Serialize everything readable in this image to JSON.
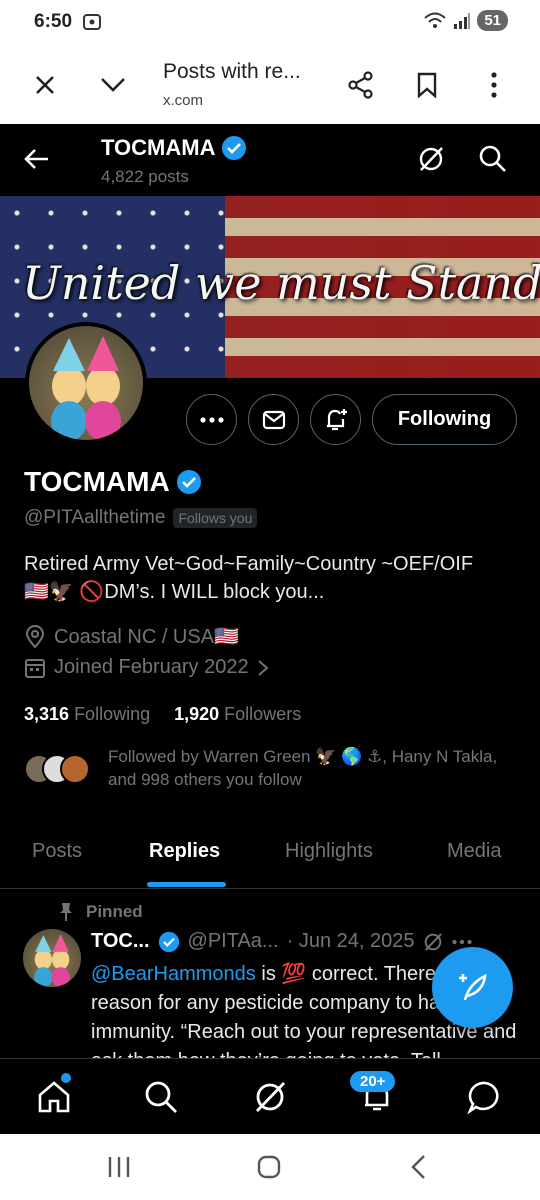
{
  "status": {
    "time": "6:50",
    "battery": "51"
  },
  "browser": {
    "title": "Posts with re...",
    "url": "x.com"
  },
  "header": {
    "name": "TOCMAMA",
    "posts": "4,822 posts"
  },
  "banner": {
    "text": "United we must Stand"
  },
  "actions": {
    "following_label": "Following"
  },
  "profile": {
    "name": "TOCMAMA",
    "handle": "@PITAallthetime",
    "follows_you": "Follows you",
    "bio_line1": "Retired Army Vet~God~Family~Country ~OEF/OIF",
    "bio_line2": "🇺🇸🦅 🚫DM’s. I WILL block you...",
    "location": "Coastal NC / USA🇺🇸",
    "joined": "Joined February 2022",
    "following_count": "3,316",
    "following_label": "Following",
    "followers_count": "1,920",
    "followers_label": "Followers",
    "followed_by": "Followed by Warren Green 🦅 🌎 ⚓, Hany N Takla, and 998 others you follow"
  },
  "tabs": [
    "Posts",
    "Replies",
    "Highlights",
    "Media"
  ],
  "tweet": {
    "pinned_label": "Pinned",
    "name": "TOC...",
    "handle": "@PITAa...",
    "date": "· Jun 24, 2025",
    "mention": "@BearHammonds",
    "body": " is 💯 correct. There is no reason for any pesticide company to have immunity. “Reach out to your representative and ask them how they’re going to vote. Tell"
  },
  "nav": {
    "notif_badge": "20+"
  },
  "colors": {
    "accent": "#1d9bf0",
    "background": "#000000",
    "muted": "#71767b"
  }
}
